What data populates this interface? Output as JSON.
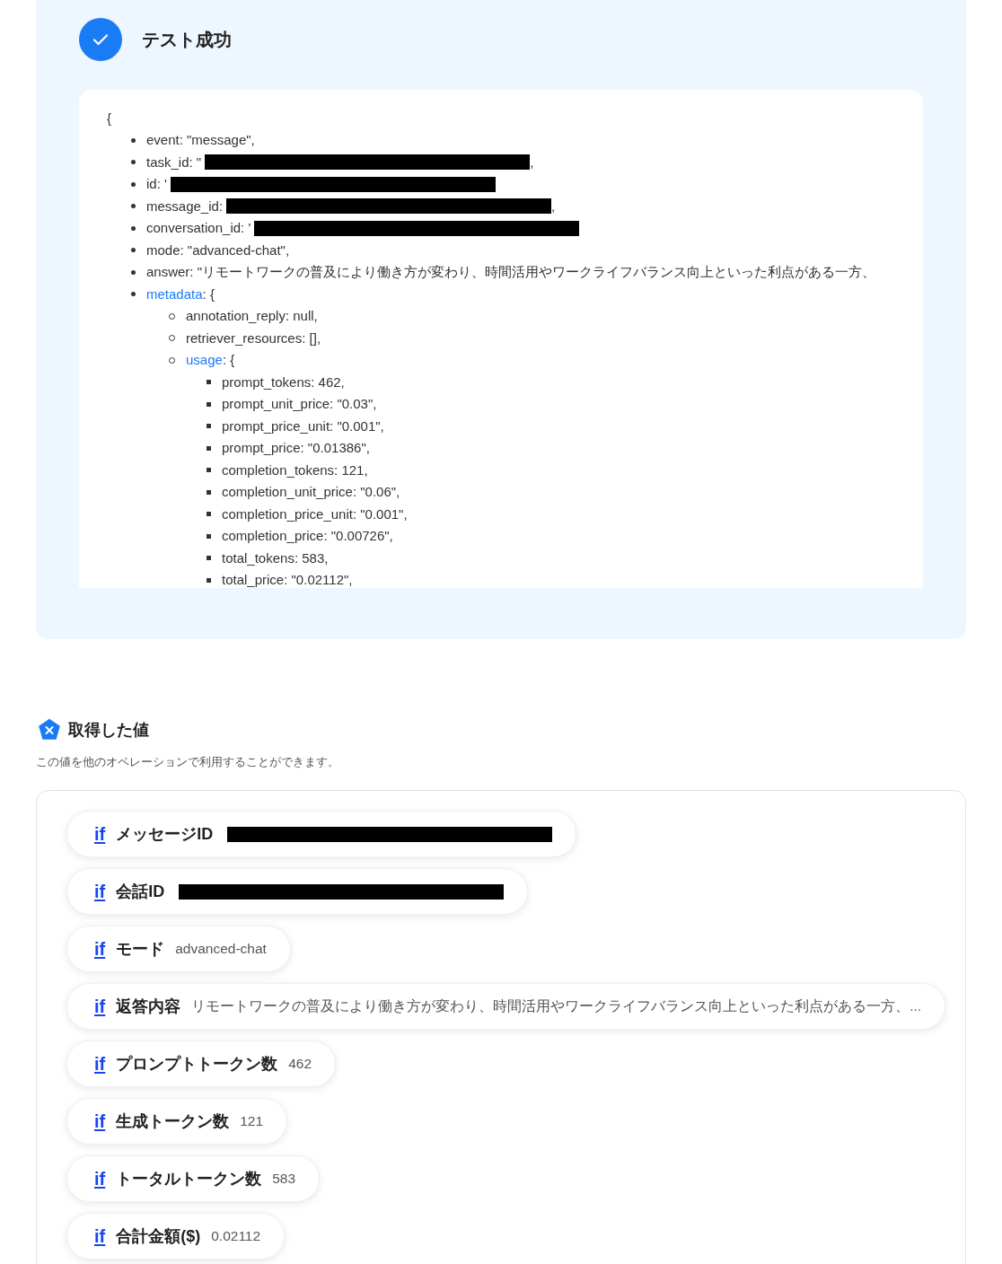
{
  "result": {
    "title": "テスト成功",
    "output": {
      "open": "{",
      "lines": [
        {
          "kind": "plain",
          "text": "event: \"message\","
        },
        {
          "kind": "redacted",
          "text": "task_id: \"",
          "after": ","
        },
        {
          "kind": "redacted",
          "text": "id: '"
        },
        {
          "kind": "redacted",
          "text": "message_id:",
          "after": ","
        },
        {
          "kind": "redacted",
          "text": "conversation_id: '"
        },
        {
          "kind": "plain",
          "text": "mode: \"advanced-chat\","
        },
        {
          "kind": "plain",
          "text": "answer: \"リモートワークの普及により働き方が変わり、時間活用やワークライフバランス向上といった利点がある一方、"
        },
        {
          "kind": "link",
          "key": "metadata",
          "text": ": {",
          "children": [
            {
              "kind": "plain",
              "text": "annotation_reply: null,"
            },
            {
              "kind": "plain",
              "text": "retriever_resources: [],"
            },
            {
              "kind": "link",
              "key": "usage",
              "text": ": {",
              "children": [
                {
                  "kind": "plain",
                  "text": "prompt_tokens: 462,"
                },
                {
                  "kind": "plain",
                  "text": "prompt_unit_price: \"0.03\","
                },
                {
                  "kind": "plain",
                  "text": "prompt_price_unit: \"0.001\","
                },
                {
                  "kind": "plain",
                  "text": "prompt_price: \"0.01386\","
                },
                {
                  "kind": "plain",
                  "text": "completion_tokens: 121,"
                },
                {
                  "kind": "plain",
                  "text": "completion_unit_price: \"0.06\","
                },
                {
                  "kind": "plain",
                  "text": "completion_price_unit: \"0.001\","
                },
                {
                  "kind": "plain",
                  "text": "completion_price: \"0.00726\","
                },
                {
                  "kind": "plain",
                  "text": "total_tokens: 583,"
                },
                {
                  "kind": "plain",
                  "text": "total_price: \"0.02112\","
                }
              ]
            }
          ]
        }
      ]
    }
  },
  "values": {
    "title": "取得した値",
    "description": "この値を他のオペレーションで利用することができます。",
    "items": [
      {
        "kind": "redacted",
        "badge": "if",
        "label": "メッセージID"
      },
      {
        "kind": "redacted",
        "badge": "if",
        "label": "会話ID"
      },
      {
        "kind": "value",
        "badge": "if",
        "label": "モード",
        "value": "advanced-chat"
      },
      {
        "kind": "value",
        "badge": "if",
        "label": "返答内容",
        "value": "リモートワークの普及により働き方が変わり、時間活用やワークライフバランス向上といった利点がある一方、..."
      },
      {
        "kind": "value",
        "badge": "if",
        "label": "プロンプトトークン数",
        "value": "462"
      },
      {
        "kind": "value",
        "badge": "if",
        "label": "生成トークン数",
        "value": "121"
      },
      {
        "kind": "value",
        "badge": "if",
        "label": "トータルトークン数",
        "value": "583"
      },
      {
        "kind": "value",
        "badge": "if",
        "label": "合計金額($)",
        "value": "0.02112"
      }
    ]
  }
}
